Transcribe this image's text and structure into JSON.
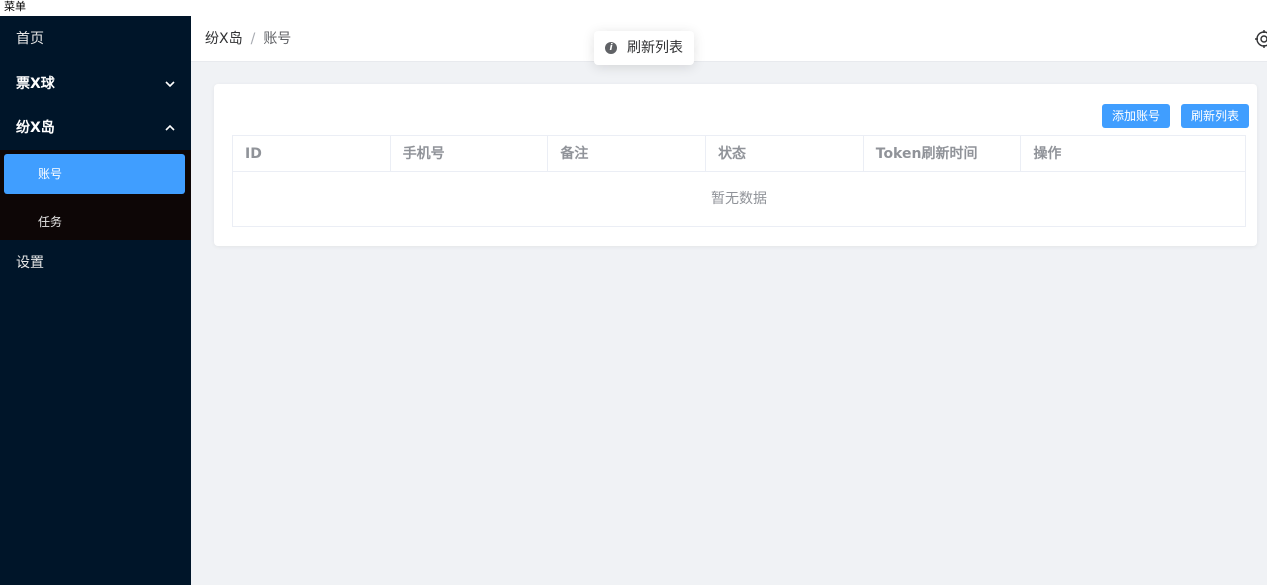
{
  "topbar": {
    "label": "菜单"
  },
  "sidebar": {
    "items": [
      {
        "label": "首页"
      },
      {
        "label": "票X球",
        "chevron": "v"
      },
      {
        "label": "纷X岛",
        "chevron": "^"
      }
    ],
    "subitems": [
      {
        "label": "账号",
        "active": true
      },
      {
        "label": "任务"
      }
    ],
    "settings": {
      "label": "设置"
    }
  },
  "header": {
    "breadcrumb": {
      "parent": "纷X岛",
      "separator": "/",
      "current": "账号"
    }
  },
  "toast": {
    "text": "刷新列表",
    "icon": "info-icon"
  },
  "card": {
    "buttons": {
      "add": "添加账号",
      "refresh": "刷新列表"
    },
    "table": {
      "columns": [
        "ID",
        "手机号",
        "备注",
        "状态",
        "Token刷新时间",
        "操作"
      ],
      "empty_text": "暂无数据"
    }
  },
  "colors": {
    "sidebar_bg": "#001529",
    "accent": "#409eff",
    "main_bg": "#f0f2f5"
  }
}
